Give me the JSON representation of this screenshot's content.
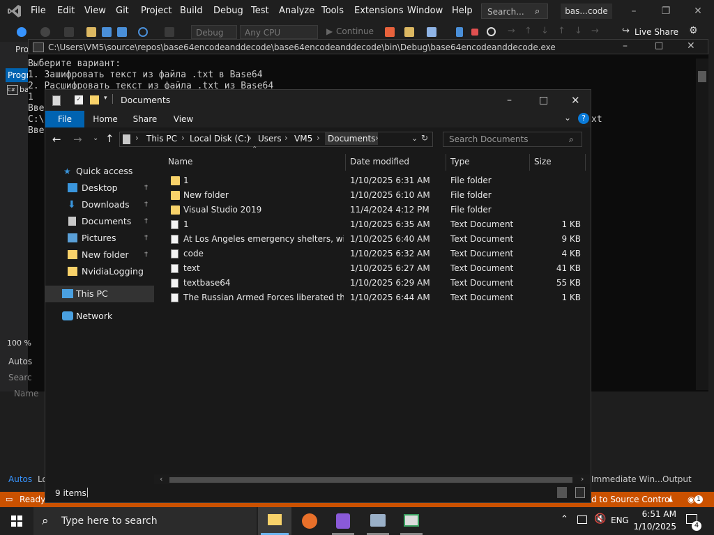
{
  "vs": {
    "menu": [
      "File",
      "Edit",
      "View",
      "Git",
      "Project",
      "Build",
      "Debug",
      "Test",
      "Analyze",
      "Tools",
      "Extensions",
      "Window",
      "Help"
    ],
    "search_placeholder": "Search...",
    "solution_name": "bas...code",
    "config": "Debug",
    "platform": "Any CPU",
    "continue_label": "Continue",
    "live_share": "Live Share",
    "left_tab": "Progr",
    "left_tab2": "Pro",
    "zoom": "100 %",
    "autos_label": "Autos",
    "search_label": "Searc",
    "name_label": "Name",
    "bottom_tab_autos": "Autos",
    "bottom_tab_lo": "Lo",
    "immediate_label": "Immediate Win...",
    "output_label": "Output",
    "status_ready": "Ready",
    "status_source": "d to Source Control",
    "notif_count": "1"
  },
  "console": {
    "title": "C:\\Users\\VM5\\source\\repos\\base64encodeanddecode\\base64encodeanddecode\\bin\\Debug\\base64encodeanddecode.exe",
    "lines": [
      "Выберите вариант:",
      "1. Зашифровать текст из файла .txt в Base64",
      "2. Расшифровать текст из файла .txt из Base64",
      "1",
      "Вве",
      "C:\\",
      "Вве"
    ],
    "suffix": "xt"
  },
  "explorer": {
    "title": "Documents",
    "ribbon_tabs": [
      "File",
      "Home",
      "Share",
      "View"
    ],
    "breadcrumb": [
      "This PC",
      "Local Disk (C:)",
      "Users",
      "VM5",
      "Documents"
    ],
    "search_placeholder": "Search Documents",
    "columns": [
      "Name",
      "Date modified",
      "Type",
      "Size"
    ],
    "nav": [
      {
        "label": "Quick access",
        "pinned": false
      },
      {
        "label": "Desktop",
        "pinned": true
      },
      {
        "label": "Downloads",
        "pinned": true
      },
      {
        "label": "Documents",
        "pinned": true
      },
      {
        "label": "Pictures",
        "pinned": true
      },
      {
        "label": "New folder",
        "pinned": true
      },
      {
        "label": "NvidiaLogging",
        "pinned": false
      },
      {
        "label": "This PC",
        "pinned": false
      },
      {
        "label": "Network",
        "pinned": false
      }
    ],
    "files": [
      {
        "name": "1",
        "date": "1/10/2025 6:31 AM",
        "type": "File folder",
        "size": "",
        "kind": "folder"
      },
      {
        "name": "New folder",
        "date": "1/10/2025 6:10 AM",
        "type": "File folder",
        "size": "",
        "kind": "folder"
      },
      {
        "name": "Visual Studio 2019",
        "date": "11/4/2024 4:12 PM",
        "type": "File folder",
        "size": "",
        "kind": "folder"
      },
      {
        "name": "1",
        "date": "1/10/2025 6:35 AM",
        "type": "Text Document",
        "size": "1 KB",
        "kind": "doc"
      },
      {
        "name": "At Los Angeles emergency shelters, wildf...",
        "date": "1/10/2025 6:40 AM",
        "type": "Text Document",
        "size": "9 KB",
        "kind": "doc"
      },
      {
        "name": "code",
        "date": "1/10/2025 6:32 AM",
        "type": "Text Document",
        "size": "4 KB",
        "kind": "doc"
      },
      {
        "name": "text",
        "date": "1/10/2025 6:27 AM",
        "type": "Text Document",
        "size": "41 KB",
        "kind": "doc"
      },
      {
        "name": "textbase64",
        "date": "1/10/2025 6:29 AM",
        "type": "Text Document",
        "size": "55 KB",
        "kind": "doc"
      },
      {
        "name": "The Russian Armed Forces liberated three...",
        "date": "1/10/2025 6:44 AM",
        "type": "Text Document",
        "size": "1 KB",
        "kind": "doc"
      }
    ],
    "status_items": "9 items"
  },
  "taskbar": {
    "search_placeholder": "Type here to search",
    "language": "ENG",
    "time": "6:51 AM",
    "date": "1/10/2025",
    "notif_count": "4"
  },
  "colors": {
    "accent_blue": "#0063b1",
    "vs_status": "#ca5100",
    "folder": "#f8d26a"
  }
}
